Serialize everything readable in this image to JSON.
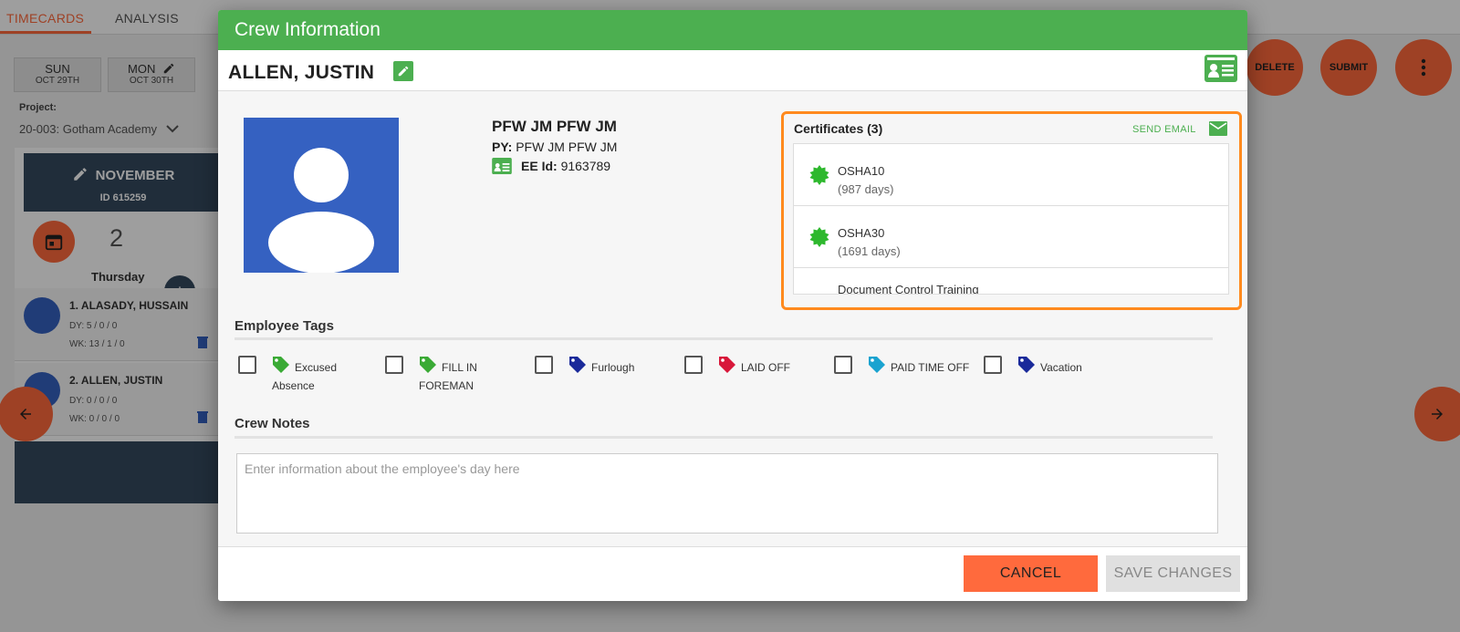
{
  "background": {
    "tabs": [
      "TIMECARDS",
      "ANALYSIS"
    ],
    "days": [
      {
        "day": "SUN",
        "date": "OCT 29TH"
      },
      {
        "day": "MON",
        "date": "OCT 30TH"
      }
    ],
    "project_label": "Project:",
    "project_value": "20-003: Gotham Academy",
    "month": "NOVEMBER",
    "month_id": "ID 615259",
    "day_number": "2",
    "day_name": "Thursday",
    "employees": [
      {
        "name": "1. ALASADY, HUSSAIN",
        "dy": "DY: 5 / 0 / 0",
        "wk": "WK: 13 / 1 / 0"
      },
      {
        "name": "2. ALLEN, JUSTIN",
        "dy": "DY: 0 / 0 / 0",
        "wk": "WK: 0 / 0 / 0"
      }
    ],
    "actions": {
      "delete": "DELETE",
      "submit": "SUBMIT"
    }
  },
  "modal": {
    "title": "Crew Information",
    "employee_name": "ALLEN, JUSTIN",
    "full_name": "PFW JM PFW JM",
    "py_label": "PY:",
    "py_value": "PFW JM PFW JM",
    "ee_label": "EE Id:",
    "ee_value": "9163789",
    "certificates": {
      "title": "Certificates (3)",
      "send_email": "SEND EMAIL",
      "items": [
        {
          "name": "OSHA10",
          "days": "(987 days)"
        },
        {
          "name": "OSHA30",
          "days": "(1691 days)"
        },
        {
          "name": "Document Control Training",
          "days": ""
        }
      ]
    },
    "tags_title": "Employee Tags",
    "tags": [
      {
        "label": "Excused Absence",
        "color": "#3aaa35"
      },
      {
        "label": "FILL IN FOREMAN",
        "color": "#3aaa35"
      },
      {
        "label": "Furlough",
        "color": "#1a2a9a"
      },
      {
        "label": "LAID OFF",
        "color": "#d8173a"
      },
      {
        "label": "PAID TIME OFF",
        "color": "#1aa3d0"
      },
      {
        "label": "Vacation",
        "color": "#1a2a9a"
      }
    ],
    "notes_title": "Crew Notes",
    "notes_placeholder": "Enter information about the employee's day here",
    "cancel_label": "CANCEL",
    "save_label": "SAVE CHANGES"
  },
  "colors": {
    "accent": "#ff6a3d",
    "header_green": "#4caf50",
    "highlight_orange": "#ff8a1e",
    "dark_navy": "#34495e"
  }
}
